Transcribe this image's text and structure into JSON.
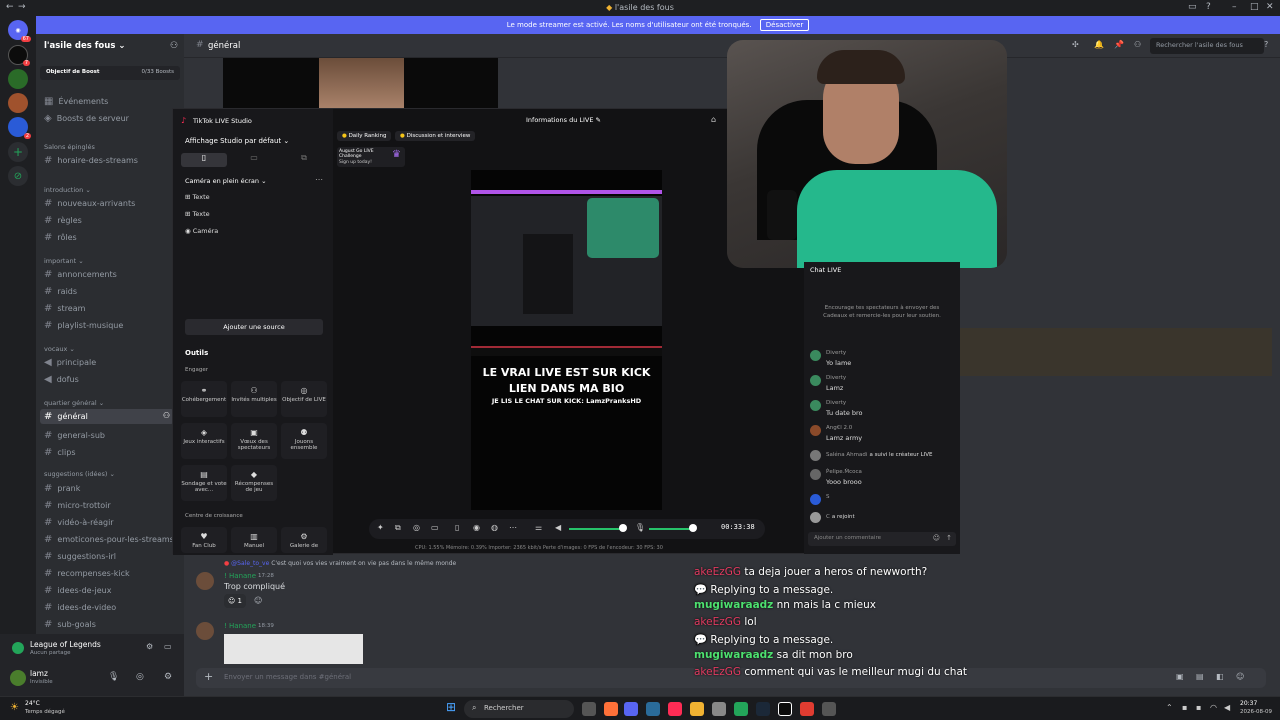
{
  "window": {
    "title": "l'asile des fous"
  },
  "banner": {
    "text": "Le mode streamer est activé. Les noms d'utilisateur ont été tronqués.",
    "button": "Désactiver"
  },
  "server": {
    "name": "l'asile des fous",
    "boost_label": "Objectif de Boost",
    "boost_count": "0/33 Boosts",
    "events": "Événements",
    "server_boosts": "Boosts de serveur"
  },
  "rail": {
    "badge1": "67",
    "badge2": "7",
    "badge3": "2",
    "badge4": "2"
  },
  "categories": {
    "pinned": "Salons épinglés",
    "intro": "introduction",
    "important": "important",
    "vocaux": "vocaux",
    "quartier": "quartier général",
    "suggestions": "suggestions (idées)"
  },
  "channels": {
    "pinned": [
      "horaire-des-streams"
    ],
    "intro": [
      "nouveaux-arrivants",
      "règles",
      "rôles"
    ],
    "important": [
      "annoncements",
      "raids",
      "stream",
      "playlist-musique"
    ],
    "vocaux": [
      "principale",
      "dofus"
    ],
    "quartier": [
      "général",
      "general-sub",
      "clips"
    ],
    "suggestions": [
      "prank",
      "micro-trottoir",
      "vidéo-à-réagir",
      "emoticones-pour-les-streams",
      "suggestions-irl",
      "recompenses-kick",
      "idees-de-jeux",
      "idees-de-video",
      "sub-goals"
    ]
  },
  "activity": {
    "game": "League of Legends",
    "sub": "Aucun partage"
  },
  "user": {
    "name": "lamz",
    "status": "Invisible"
  },
  "header": {
    "channel": "général",
    "search": "Rechercher l'asile des fous"
  },
  "studio": {
    "app": "TikTok LIVE Studio",
    "layout": "Affichage Studio par défaut",
    "scene": "Caméra en plein écran",
    "sources": [
      "Texte",
      "Texte",
      "Caméra"
    ],
    "add_source": "Ajouter une source",
    "tools_title": "Outils",
    "engage": "Engager",
    "tools": [
      "Cohébergement",
      "Invités multiples",
      "Objectif de LIVE",
      "Jeux interactifs",
      "Vœux des spectateurs",
      "Jouons ensemble",
      "Sondage et vote avec...",
      "Récompenses de jeu"
    ],
    "growth": "Centre de croissance",
    "tools2": [
      "Fan Club",
      "Manuel",
      "Galerie de"
    ],
    "tabs": [
      "Daily Ranking",
      "Discussion et interview"
    ],
    "challenge": "August Go LIVE Challenge",
    "challenge_sub": "Sign up today!",
    "info_title": "Informations du LIVE",
    "preview_line1": "LE VRAI LIVE EST SUR KICK",
    "preview_line2": "LIEN DANS MA BIO",
    "preview_line3": "JE LIS LE CHAT SUR KICK: LamzPranksHD",
    "timer": "00:33:38",
    "stats": "CPU: 1.55%   Mémoire: 0.39%   Importer: 2365 kbit/s   Perte d'images: 0   FPS de l'encodeur: 30   FPS: 30"
  },
  "live_chat": {
    "title": "Chat LIVE",
    "empty": "Encourage tes spectateurs à envoyer des Cadeaux et remercie-les pour leur soutien.",
    "messages": [
      {
        "name": "Diverty",
        "text": "Yo lame"
      },
      {
        "name": "Diverty",
        "text": "Lamz"
      },
      {
        "name": "Diverty",
        "text": "Tu date bro"
      },
      {
        "name": "Ang€l 2.0",
        "text": "Lamz army"
      },
      {
        "name": "Saléna Ahmadi",
        "text": "a suivi le créateur LIVE"
      },
      {
        "name": "Ṗelipe.Ṁcoca",
        "text": "Yooo brooo"
      },
      {
        "name": "S",
        "text": ""
      },
      {
        "name": "C",
        "text": "a rejoint"
      }
    ],
    "input": "Ajouter un commentaire"
  },
  "messages": {
    "reply_ref": "C'est quoi vos vies vraiment on vie pas dans le même monde",
    "reply_user": "@Sale_to_ve",
    "author1": "! Hanane",
    "time1": "17:28",
    "text1": "Trop compliqué",
    "reaction": "1",
    "author2": "! Hanane",
    "time2": "18:39",
    "input_placeholder": "Envoyer un message dans #général"
  },
  "overlay": [
    {
      "user": "akeEzGG",
      "text": "ta deja jouer a heros of newworth?",
      "color": "#e23a60"
    },
    {
      "user": "",
      "text": "💬 Replying to a message.",
      "color": "#ffffff"
    },
    {
      "user": "mugiwaraadz",
      "text": "nn mais la c mieux",
      "color": "#4de06f"
    },
    {
      "user": "akeEzGG",
      "text": "lol",
      "color": "#e23a60"
    },
    {
      "user": "",
      "text": "💬 Replying to a message.",
      "color": "#ffffff"
    },
    {
      "user": "mugiwaraadz",
      "text": "sa dit mon bro",
      "color": "#4de06f"
    },
    {
      "user": "akeEzGG",
      "text": "comment qui vas le meilleur mugi du chat",
      "color": "#e23a60"
    }
  ],
  "taskbar": {
    "weather_temp": "24°C",
    "weather_text": "Temps dégagé",
    "search": "Rechercher",
    "time": "20:37",
    "date": "2026-08-09"
  }
}
